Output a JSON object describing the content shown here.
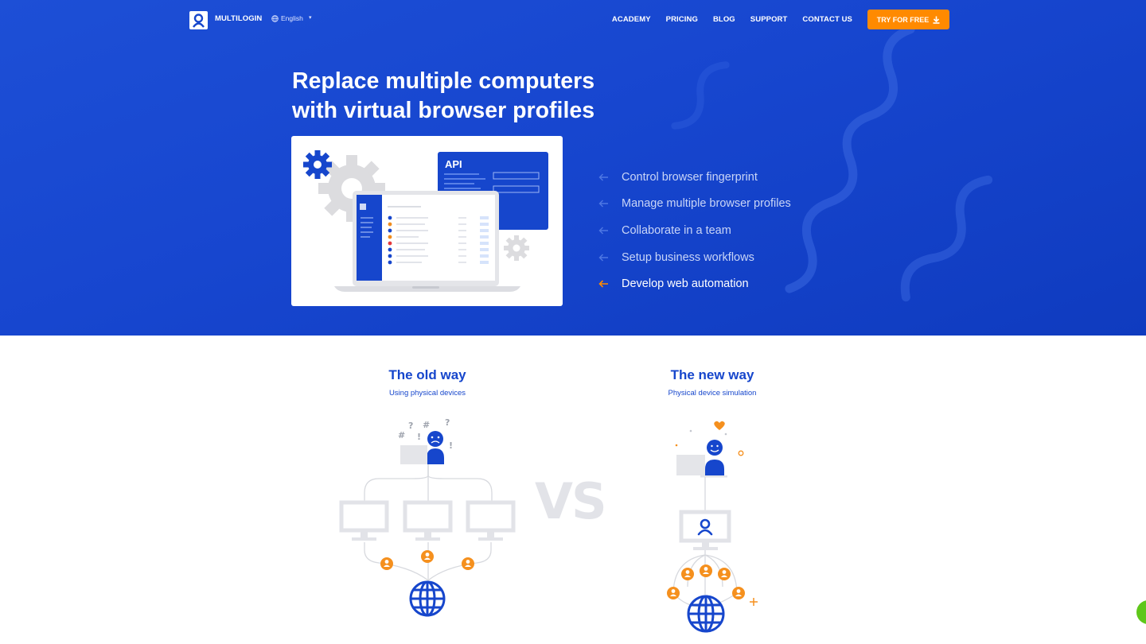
{
  "nav": {
    "brand": "MULTILOGIN",
    "language": "English",
    "items": [
      {
        "label": "ACADEMY"
      },
      {
        "label": "PRICING"
      },
      {
        "label": "BLOG"
      },
      {
        "label": "SUPPORT"
      },
      {
        "label": "CONTACT US"
      }
    ],
    "cta": "TRY FOR FREE"
  },
  "hero": {
    "headline_line1": "Replace multiple computers",
    "headline_line2": "with virtual browser profiles",
    "illustration": {
      "api_label": "API"
    },
    "features": [
      {
        "label": "Control browser fingerprint",
        "active": false
      },
      {
        "label": "Manage multiple browser profiles",
        "active": false
      },
      {
        "label": "Collaborate in a team",
        "active": false
      },
      {
        "label": "Setup business workflows",
        "active": false
      },
      {
        "label": "Develop web automation",
        "active": true
      }
    ]
  },
  "comparison": {
    "old": {
      "title": "The old way",
      "subtitle": "Using physical devices",
      "symbols": [
        "#",
        "?",
        "!",
        "#",
        "?",
        "!"
      ]
    },
    "vs": "VS",
    "new": {
      "title": "The new way",
      "subtitle": "Physical device simulation"
    }
  },
  "colors": {
    "brand_blue": "#1646cc",
    "accent_orange": "#ff8a00",
    "chat_green": "#5fc71a"
  }
}
